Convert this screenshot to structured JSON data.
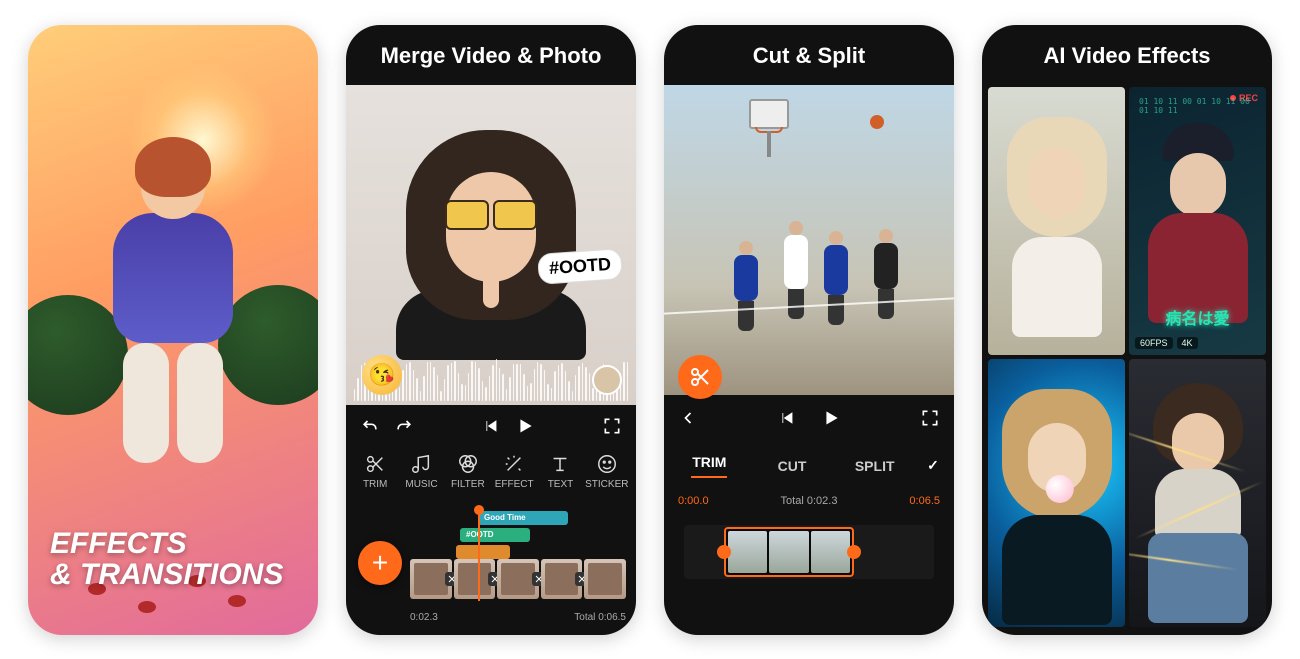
{
  "panel1": {
    "caption_line1": "EFFECTS",
    "caption_line2": "& TRANSITIONS"
  },
  "panel2": {
    "title": "Merge Video & Photo",
    "sticker_ootd": "#OOTD",
    "emoji": "😘",
    "tools": [
      {
        "id": "trim",
        "label": "TRIM"
      },
      {
        "id": "music",
        "label": "MUSIC"
      },
      {
        "id": "filter",
        "label": "FILTER"
      },
      {
        "id": "effect",
        "label": "EFFECT"
      },
      {
        "id": "text",
        "label": "TEXT"
      },
      {
        "id": "sticker",
        "label": "STICKER"
      }
    ],
    "layers": {
      "l1": "Good Time",
      "l2": "#OOTD",
      "l3": ""
    },
    "time_current": "0:02.3",
    "time_total_label": "Total",
    "time_total": "0:06.5"
  },
  "panel3": {
    "title": "Cut & Split",
    "tabs": [
      {
        "id": "trim",
        "label": "TRIM",
        "active": true
      },
      {
        "id": "cut",
        "label": "CUT",
        "active": false
      },
      {
        "id": "split",
        "label": "SPLIT",
        "active": false
      }
    ],
    "check": "✓",
    "time_start": "0:00.0",
    "time_mid_label": "Total",
    "time_mid": "0:02.3",
    "time_end": "0:06.5"
  },
  "panel4": {
    "title": "AI Video Effects",
    "cell2": {
      "rec": "REC",
      "kanji": "病名は愛",
      "tag1": "60FPS",
      "tag2": "4K"
    }
  }
}
